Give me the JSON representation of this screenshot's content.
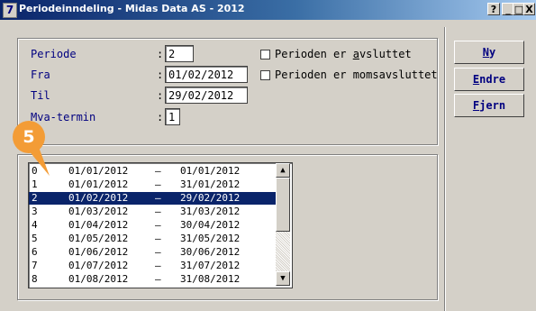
{
  "window": {
    "icon_glyph": "7",
    "title": "Periodeinndeling - Midas Data AS - 2012",
    "controls": [
      "?",
      "_",
      "□",
      "X"
    ]
  },
  "form": {
    "periode": {
      "label": "Periode",
      "value": "2"
    },
    "fra": {
      "label": "Fra",
      "value": "01/02/2012"
    },
    "til": {
      "label": "Til",
      "value": "29/02/2012"
    },
    "mva": {
      "label": "Mva-termin",
      "value": "1"
    },
    "colon": ":",
    "check_avsluttet": {
      "pre": "Perioden er ",
      "accel": "a",
      "post": "vsluttet",
      "checked": false
    },
    "check_moms": {
      "label": "Perioden er momsavsluttet",
      "checked": false
    }
  },
  "buttons": {
    "ny": {
      "accel": "N",
      "rest": "y"
    },
    "endre": {
      "accel": "E",
      "rest": "ndre"
    },
    "fjern": {
      "accel": "F",
      "rest": "jern"
    }
  },
  "callout": "5",
  "list": {
    "dash": "–",
    "rows": [
      {
        "num": "0",
        "from": "01/01/2012",
        "to": "01/01/2012"
      },
      {
        "num": "1",
        "from": "01/01/2012",
        "to": "31/01/2012"
      },
      {
        "num": "2",
        "from": "01/02/2012",
        "to": "29/02/2012",
        "selected": true
      },
      {
        "num": "3",
        "from": "01/03/2012",
        "to": "31/03/2012"
      },
      {
        "num": "4",
        "from": "01/04/2012",
        "to": "30/04/2012"
      },
      {
        "num": "5",
        "from": "01/05/2012",
        "to": "31/05/2012"
      },
      {
        "num": "6",
        "from": "01/06/2012",
        "to": "30/06/2012"
      },
      {
        "num": "7",
        "from": "01/07/2012",
        "to": "31/07/2012"
      },
      {
        "num": "8",
        "from": "01/08/2012",
        "to": "31/08/2012"
      }
    ]
  },
  "scrollbar": {
    "up": "▲",
    "down": "▼"
  }
}
